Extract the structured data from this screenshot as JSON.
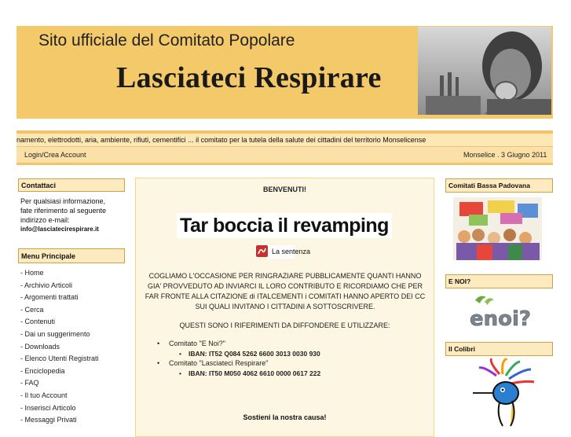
{
  "header": {
    "subtitle": "Sito ufficiale del Comitato Popolare",
    "title": "Lasciateci Respirare"
  },
  "ticker": {
    "text": "namento, elettrodotti, aria, ambiente, rifiuti, cementifici ... il comitato per la tutela della salute dei cittadini del territorio Monselicense"
  },
  "infobar": {
    "login": "Login/Crea Account",
    "date": "Monselice . 3 Giugno 2011"
  },
  "contatti": {
    "title": "Contattaci",
    "line1": "Per qualsiasi informazione,",
    "line2": "fate riferimento al seguente",
    "line3": "indirizzo e-mail:",
    "email": "info@lasciatecirespirare.it"
  },
  "menu": {
    "title": "Menu Principale",
    "items": [
      "- Home",
      "- Archivio Articoli",
      "- Argomenti trattati",
      "- Cerca",
      "- Contenuti",
      "- Dai un suggerimento",
      "- Downloads",
      "- Elenco Utenti Registrati",
      "- Enciclopedia",
      "- FAQ",
      "- Il tuo Account",
      "- Inserisci Articolo",
      "- Messaggi Privati"
    ]
  },
  "main": {
    "welcome": "BENVENUTI!",
    "headline": "Tar boccia il revamping",
    "sentenza_link": "La sentenza",
    "paragraph": "COGLIAMO L'OCCASIONE PER RINGRAZIARE PUBBLICAMENTE QUANTI HANNO GIA' PROVVEDUTO AD INVIARCI IL LORO CONTRIBUTO E RICORDIAMO CHE PER FAR FRONTE ALLA CITAZIONE di ITALCEMENTI i COMITATI HANNO APERTO DEI CC SUI QUALI INVITANO I CITTADINI A SOTTOSCRIVERE.",
    "references": "QUESTI SONO I RIFERIMENTI DA DIFFONDERE E UTILIZZARE:",
    "accounts": [
      {
        "name": "Comitato \"E Noi?\"",
        "iban": "IBAN: IT52 Q084 5262 6600 3013 0030 930"
      },
      {
        "name": "Comitato \"Lasciateci Respirare\"",
        "iban": "IBAN: IT50 M050 4062 6610 0000 0617 222"
      }
    ],
    "support": "Sostieni la nostra causa!"
  },
  "right": {
    "block1": "Comitati Bassa Padovana",
    "block2": "E NOI?",
    "block3": "Il Colibri",
    "logo_text": "enoi?"
  },
  "colors": {
    "header_bg": "#f3c969",
    "box_head_bg": "#fdeabf",
    "content_bg": "#fdf6e3"
  }
}
